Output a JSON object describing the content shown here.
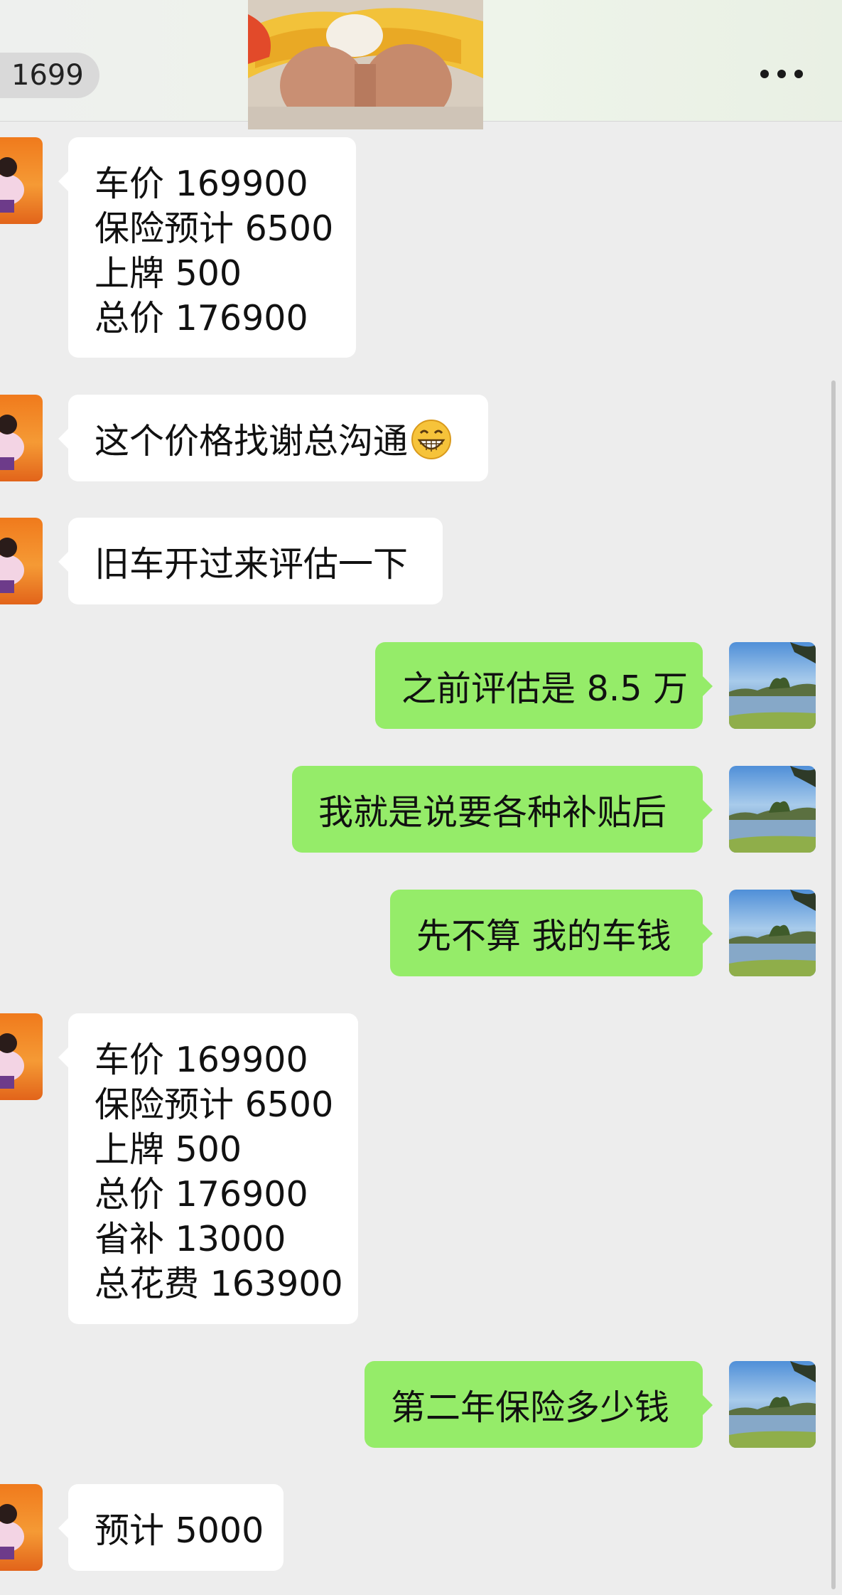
{
  "header": {
    "badge": "1699",
    "more_icon": "more-dots-icon"
  },
  "messages": [
    {
      "side": "in",
      "lines": [
        "车价 169900",
        "保险预计 6500",
        "上牌 500",
        "总价 176900"
      ]
    },
    {
      "side": "in",
      "text": "这个价格找谢总沟通",
      "emoji": "grinning-face-icon"
    },
    {
      "side": "in",
      "text": "旧车开过来评估一下"
    },
    {
      "side": "out",
      "text": "之前评估是 8.5 万"
    },
    {
      "side": "out",
      "text": "我就是说要各种补贴后"
    },
    {
      "side": "out",
      "text": "先不算 我的车钱"
    },
    {
      "side": "in",
      "lines": [
        "车价 169900",
        "保险预计 6500",
        "上牌 500",
        "总价 176900",
        "省补 13000",
        "总花费 163900"
      ]
    },
    {
      "side": "out",
      "text": "第二年保险多少钱"
    },
    {
      "side": "in",
      "text": "预计 5000"
    }
  ],
  "colors": {
    "background": "#ededed",
    "incoming_bubble": "#ffffff",
    "outgoing_bubble": "#95ec69"
  }
}
